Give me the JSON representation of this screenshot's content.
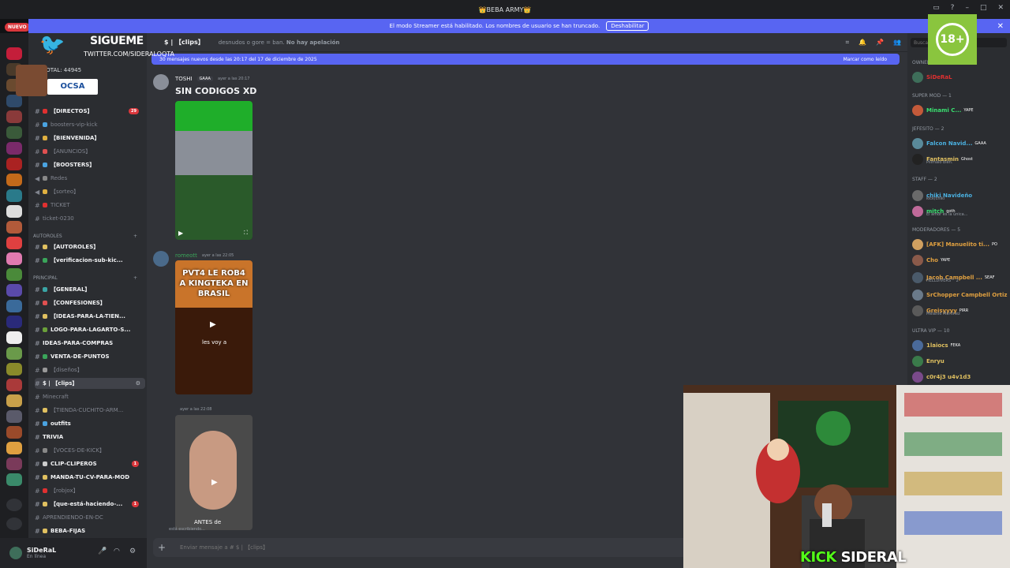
{
  "titlebar": {
    "title": "👑BEBA ARMY👑",
    "new_label": "NUEVO"
  },
  "streamer_banner": {
    "text": "El modo Streamer está habilitado. Los nombres de usuario se han truncado.",
    "button": "Deshabilitar"
  },
  "channel_header": {
    "name": "$ | 【clips】",
    "topic_prefix": "desnudos o gore = ban.",
    "topic_bold": "No hay apelación"
  },
  "new_messages_bar": {
    "text": "30 mensajes nuevos desde las 20:17 del 17 de diciembre de 2025",
    "action": "Marcar como leído"
  },
  "sidebar": {
    "total": "TOTAL: 44945",
    "channels": [
      {
        "label": "【DIRECTOS】",
        "unread": "29"
      },
      {
        "label": "boosters-vip-kick"
      },
      {
        "label": "【BIENVENIDA】"
      },
      {
        "label": "【ANUNCIOS】"
      },
      {
        "label": "【BOOSTERS】"
      },
      {
        "label": "Redes"
      },
      {
        "label": "【sorteo】"
      },
      {
        "label": "TICKET"
      },
      {
        "label": "ticket-0230"
      }
    ],
    "category_autoroles": "AUTOROLES",
    "autoroles_channels": [
      {
        "label": "【AUTOROLES】"
      },
      {
        "label": "【verificacion-sub-kic..."
      }
    ],
    "category_principal": "PRINCIPAL",
    "principal_channels": [
      {
        "label": "【GENERAL】"
      },
      {
        "label": "【CONFESIONES】"
      },
      {
        "label": "【IDEAS-PARA-LA-TIEN..."
      },
      {
        "label": "LOGO-PARA-LAGARTO-S..."
      },
      {
        "label": "IDEAS-PARA-COMPRAS"
      },
      {
        "label": "VENTA-DE-PUNTOS"
      },
      {
        "label": "【diseños】"
      },
      {
        "label": "$ | 【clips】"
      },
      {
        "label": "Minecraft"
      },
      {
        "label": "【TIENDA-CUCHITO-ARM..."
      },
      {
        "label": "outfits"
      },
      {
        "label": "TRIVIA"
      },
      {
        "label": "【VOCES-DE-KICK】"
      },
      {
        "label": "CLIP-CLIPEROS",
        "unread": "1"
      },
      {
        "label": "MANDA-TU-CV-PARA-MOD"
      },
      {
        "label": "【robjox】"
      },
      {
        "label": "【que-está-haciendo-...",
        "unread": "1"
      },
      {
        "label": "APRENDIENDO-EN-DC"
      },
      {
        "label": "BEBA-FIJAS"
      }
    ]
  },
  "user_panel": {
    "name": "SiDeRaL",
    "status": "En línea"
  },
  "messages": [
    {
      "author": "TOSHI",
      "tag": "GAAA",
      "time": "ayer a las 20:17",
      "body": "SIN CODIGOS XD"
    },
    {
      "author": "romeott",
      "time": "ayer a las 22:05",
      "video_caption": "PVT4 LE ROB4 A KINGTEKA EN BRASIL",
      "video_sub": "les voy a"
    },
    {
      "author": "",
      "time": "ayer a las 22:08",
      "video_sub": "ANTES de"
    }
  ],
  "typing_text": "está escribiendo...",
  "composer": {
    "placeholder": "Enviar mensaje a # $ | 【clips】"
  },
  "members": {
    "search_placeholder": "Buscar",
    "owner_label": "OWNER — 1",
    "owner": "SiDeRaL",
    "supermod_label": "SUPER MOD — 1",
    "supermod": [
      {
        "name": "Minami C...",
        "tag": "YAPE"
      }
    ],
    "jefesito_label": "JEFESITO — 2",
    "jefesito": [
      {
        "name": "Falcon Navid...",
        "tag": "GAAA"
      },
      {
        "name": "Fantasmin",
        "tag": "Ghost",
        "sub": "Pilimalo bien."
      }
    ],
    "staff_label": "STAFF — 2",
    "staff": [
      {
        "name": "chiki Navideño",
        "sub": "kick/chiki"
      },
      {
        "name": "mitch",
        "tag": "goth",
        "sub": "El amor es la única..."
      }
    ],
    "mods_label": "MODERADORES — 5",
    "mods": [
      {
        "name": "[AFK] Manuelito ti...",
        "tag": "PO"
      },
      {
        "name": "Cho",
        "tag": "YAPE"
      },
      {
        "name": "Jacob Campbell ...",
        "tag": "SEAF",
        "sub": "HELLDIVERS™ 2"
      },
      {
        "name": "SrChopper Campbell Ortiz"
      },
      {
        "name": "Greisyyyy",
        "tag": "PIRR",
        "sub": "Melanie Martinez"
      }
    ],
    "ultravip_label": "ULTRA VIP — 10",
    "ultravip": [
      {
        "name": "1laiocs",
        "tag": "FEKA"
      },
      {
        "name": "Enryu"
      },
      {
        "name": "c0r4j3 u4v1d3",
        "tag": ""
      }
    ]
  },
  "overlays": {
    "twitter_line1": "SIGUEME",
    "twitter_line2": "TWITTER.COM/SIDERALOQTA",
    "sponsor": "OCSA",
    "age_badge": "18+",
    "kick_watermark_kick": "KICK",
    "kick_watermark_name": "SIDERAL"
  },
  "colors": {
    "accent": "#5865f2",
    "kick_green": "#53fc18",
    "danger": "#da373c"
  }
}
